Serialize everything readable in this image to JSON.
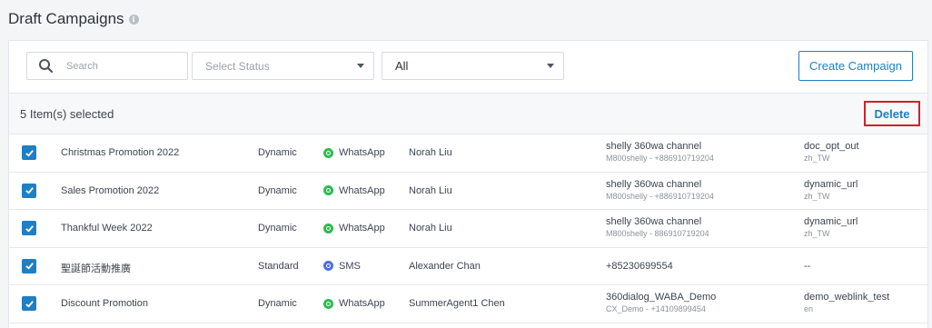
{
  "page": {
    "title": "Draft Campaigns",
    "info_icon": "info-icon"
  },
  "toolbar": {
    "search_placeholder": "Search",
    "status_select": "Select Status",
    "type_select": "All",
    "create_label": "Create Campaign"
  },
  "selection": {
    "count_label": "5 Item(s) selected",
    "delete_label": "Delete"
  },
  "colors": {
    "accent": "#1e7fc4",
    "whatsapp": "#2dbb52",
    "sms": "#4f6ee0",
    "highlight": "#d0202b"
  },
  "rows": [
    {
      "name": "Christmas Promotion 2022",
      "type": "Dynamic",
      "channel": "WhatsApp",
      "channel_icon": "whatsapp-icon",
      "agent": "Norah Liu",
      "account": "shelly 360wa channel",
      "account_sub": "M800shelly - +886910719204",
      "template": "doc_opt_out",
      "template_sub": "zh_TW",
      "checked": true
    },
    {
      "name": "Sales Promotion 2022",
      "type": "Dynamic",
      "channel": "WhatsApp",
      "channel_icon": "whatsapp-icon",
      "agent": "Norah Liu",
      "account": "shelly 360wa channel",
      "account_sub": "M800shelly - +886910719204",
      "template": "dynamic_url",
      "template_sub": "zh_TW",
      "checked": true
    },
    {
      "name": "Thankful Week 2022",
      "type": "Dynamic",
      "channel": "WhatsApp",
      "channel_icon": "whatsapp-icon",
      "agent": "Norah Liu",
      "account": "shelly 360wa channel",
      "account_sub": "M800shelly - 886910719204",
      "template": "dynamic_url",
      "template_sub": "zh_TW",
      "checked": true
    },
    {
      "name": "聖誕節活動推廣",
      "type": "Standard",
      "channel": "SMS",
      "channel_icon": "sms-icon",
      "agent": "Alexander Chan",
      "account": "+85230699554",
      "account_sub": "",
      "template": "--",
      "template_sub": "",
      "checked": true
    },
    {
      "name": "Discount Promotion",
      "type": "Dynamic",
      "channel": "WhatsApp",
      "channel_icon": "whatsapp-icon",
      "agent": "SummerAgent1 Chen",
      "account": "360dialog_WABA_Demo",
      "account_sub": "CX_Demo - +14109899454",
      "template": "demo_weblink_test",
      "template_sub": "en",
      "checked": true
    }
  ]
}
